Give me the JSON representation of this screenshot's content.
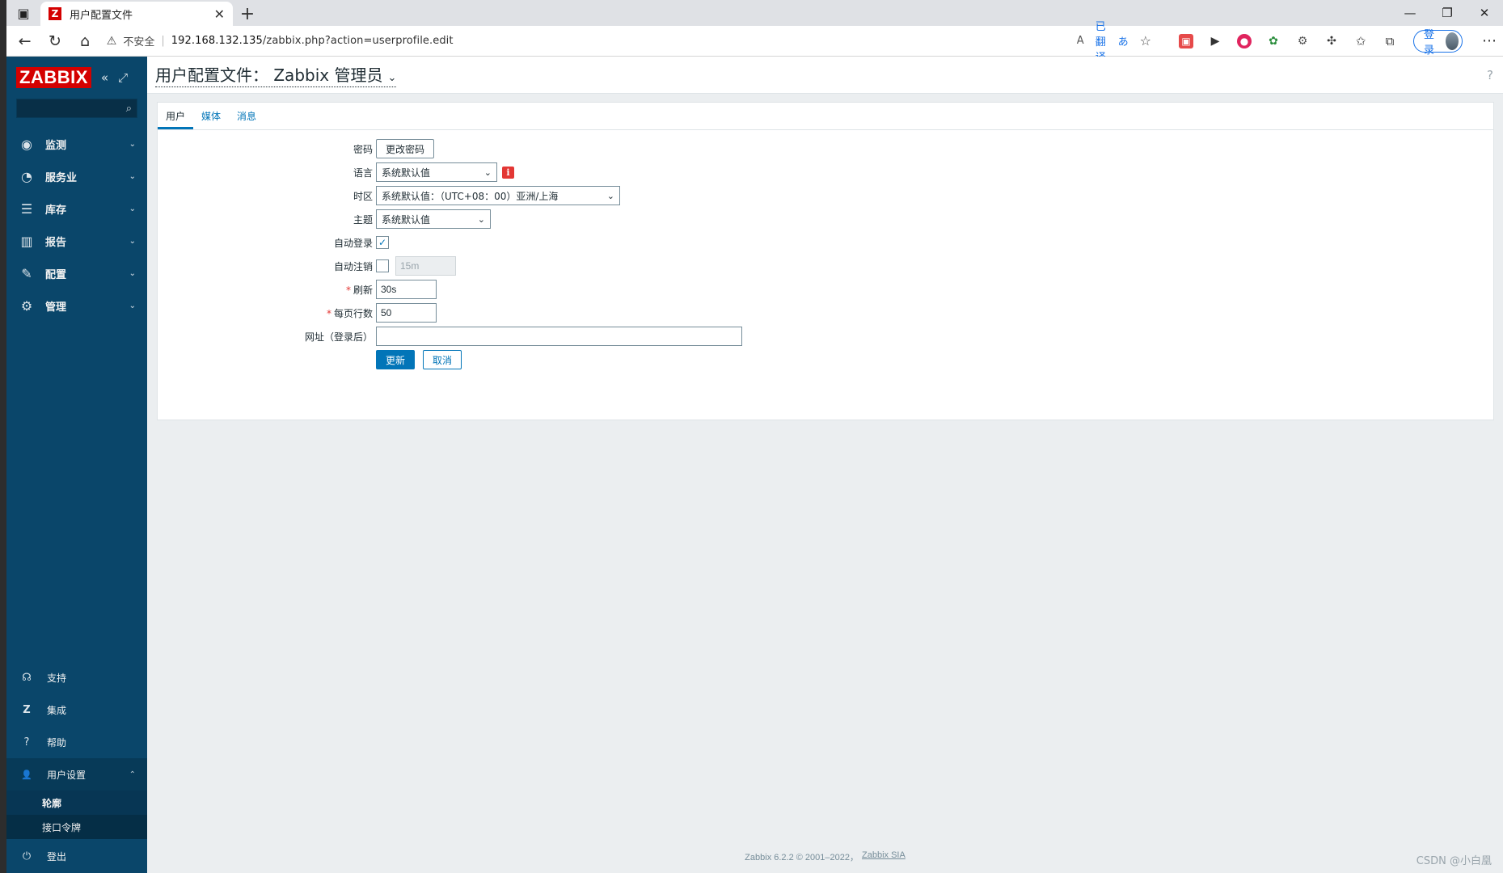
{
  "browser": {
    "tab_title": "用户配置文件",
    "tab_favicon": "Z",
    "address": {
      "security_label": "不安全",
      "host": "192.168.132.135",
      "path": "/zabbix.php?action=userprofile.edit"
    },
    "translated_label": "已翻译",
    "login_label": "登录",
    "icons": {
      "back": "←",
      "refresh": "↻",
      "home": "⌂",
      "warn": "⚠",
      "read_aloud": "A",
      "translate": "あ",
      "star": "☆",
      "favorites": "✩",
      "collections": "⧉",
      "menu": "⋯",
      "minimize": "—",
      "restore": "❐",
      "close": "✕",
      "new_tab": "+",
      "tab_close": "✕",
      "tab_actions": "▣"
    }
  },
  "sidebar": {
    "logo": "ZABBIX",
    "collapse_icon": "«",
    "kiosk_icon": "⤢",
    "search_icon": "⌕",
    "menu": [
      {
        "label": "监测",
        "icon": "◉"
      },
      {
        "label": "服务业",
        "icon": "◔"
      },
      {
        "label": "库存",
        "icon": "☰"
      },
      {
        "label": "报告",
        "icon": "▥"
      },
      {
        "label": "配置",
        "icon": "✎"
      },
      {
        "label": "管理",
        "icon": "⚙"
      }
    ],
    "chevron_down": "⌄",
    "chevron_up": "⌃",
    "bottom": {
      "support": {
        "label": "支持",
        "icon": "☊"
      },
      "integrations": {
        "label": "集成",
        "icon": "Z"
      },
      "help": {
        "label": "帮助",
        "icon": "?"
      },
      "user_settings": {
        "label": "用户设置",
        "icon": "👤"
      },
      "sub_profile": "轮廓",
      "sub_api_tokens": "接口令牌",
      "logout": {
        "label": "登出",
        "icon": "⏻"
      }
    }
  },
  "page": {
    "title": "用户配置文件： Zabbix 管理员",
    "title_chevron": "⌄",
    "help_icon": "?",
    "tabs": [
      "用户",
      "媒体",
      "消息"
    ],
    "form": {
      "password_label": "密码",
      "change_password_button": "更改密码",
      "language_label": "语言",
      "language_value": "系统默认值",
      "language_info_icon": "i",
      "timezone_label": "时区",
      "timezone_value": "系统默认值：（UTC+08：00）亚洲/上海",
      "theme_label": "主题",
      "theme_value": "系统默认值",
      "autologin_label": "自动登录",
      "autologin_checked": true,
      "autologin_mark": "✓",
      "autologout_label": "自动注销",
      "autologout_checked": false,
      "autologout_value": "15m",
      "refresh_label": "刷新",
      "refresh_value": "30s",
      "rows_per_page_label": "每页行数",
      "rows_per_page_value": "50",
      "url_label": "网址（登录后）",
      "url_value": "",
      "required_mark": "*",
      "update_button": "更新",
      "cancel_button": "取消",
      "select_arrow": "⌄"
    }
  },
  "footer": {
    "copyright": "Zabbix 6.2.2 © 2001–2022，",
    "company_link": "Zabbix SIA"
  },
  "watermark": "CSDN @小白凰"
}
